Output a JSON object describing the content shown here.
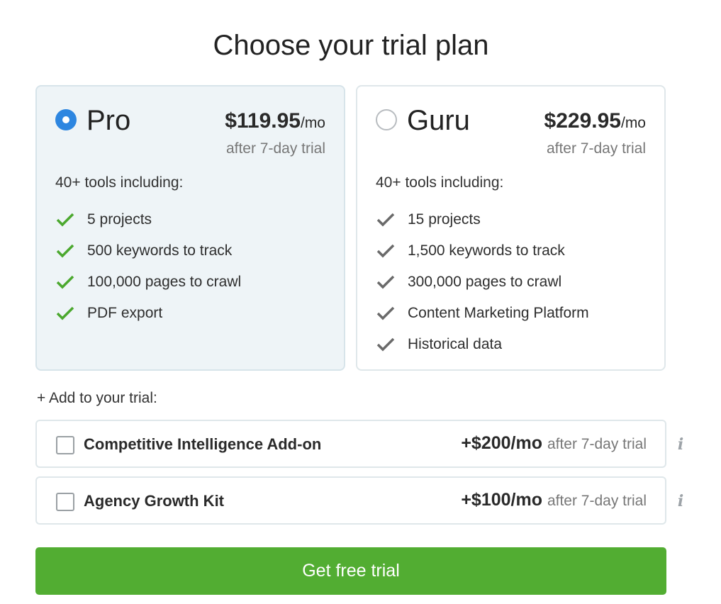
{
  "page": {
    "title": "Choose your trial plan"
  },
  "plans": [
    {
      "name": "Pro",
      "selected": true,
      "price": "$119.95",
      "period": "/mo",
      "after": "after 7-day trial",
      "tools_heading": "40+ tools including:",
      "check_color": "#4ba82e",
      "features": [
        "5 projects",
        "500 keywords to track",
        "100,000 pages to crawl",
        "PDF export"
      ]
    },
    {
      "name": "Guru",
      "selected": false,
      "price": "$229.95",
      "period": "/mo",
      "after": "after 7-day trial",
      "tools_heading": "40+ tools including:",
      "check_color": "#6a6a6a",
      "features": [
        "15 projects",
        "1,500 keywords to track",
        "300,000 pages to crawl",
        "Content Marketing Platform",
        "Historical data"
      ]
    }
  ],
  "addons": {
    "label": "+ Add to your trial:",
    "items": [
      {
        "name": "Competitive Intelligence Add-on",
        "price": "+$200/mo",
        "after": "after 7-day trial",
        "checked": false,
        "info": "i"
      },
      {
        "name": "Agency Growth Kit",
        "price": "+$100/mo",
        "after": "after 7-day trial",
        "checked": false,
        "info": "i"
      }
    ]
  },
  "cta": {
    "label": "Get free trial",
    "color": "#52ad32"
  }
}
